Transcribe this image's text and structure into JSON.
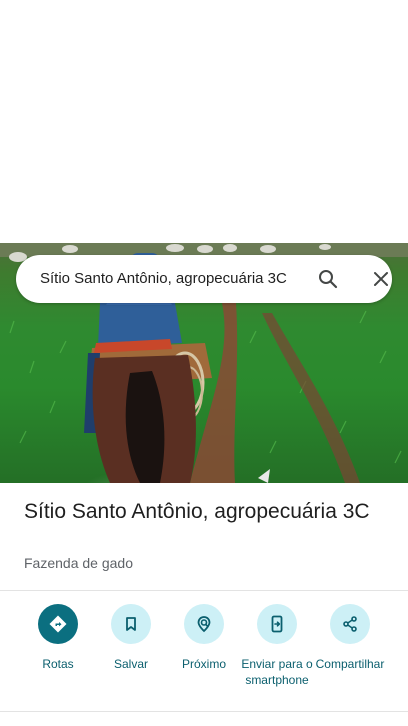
{
  "search": {
    "query": "Sítio Santo Antônio, agropecuária 3C",
    "search_icon": "search-icon",
    "close_icon": "close-icon"
  },
  "place": {
    "name": "Sítio Santo Antônio, agropecuária 3C",
    "category": "Fazenda de gado"
  },
  "actions": [
    {
      "label": "Rotas",
      "icon": "directions-icon"
    },
    {
      "label": "Salvar",
      "icon": "bookmark-icon"
    },
    {
      "label": "Próximo",
      "icon": "nearby-icon"
    },
    {
      "label": "Enviar para o smartphone",
      "icon": "send-to-phone-icon"
    },
    {
      "label": "Compartilhar",
      "icon": "share-icon"
    }
  ],
  "colors": {
    "accent": "#0b6f80",
    "accent_light": "#cdf0f6",
    "label": "#0b5f6e"
  }
}
